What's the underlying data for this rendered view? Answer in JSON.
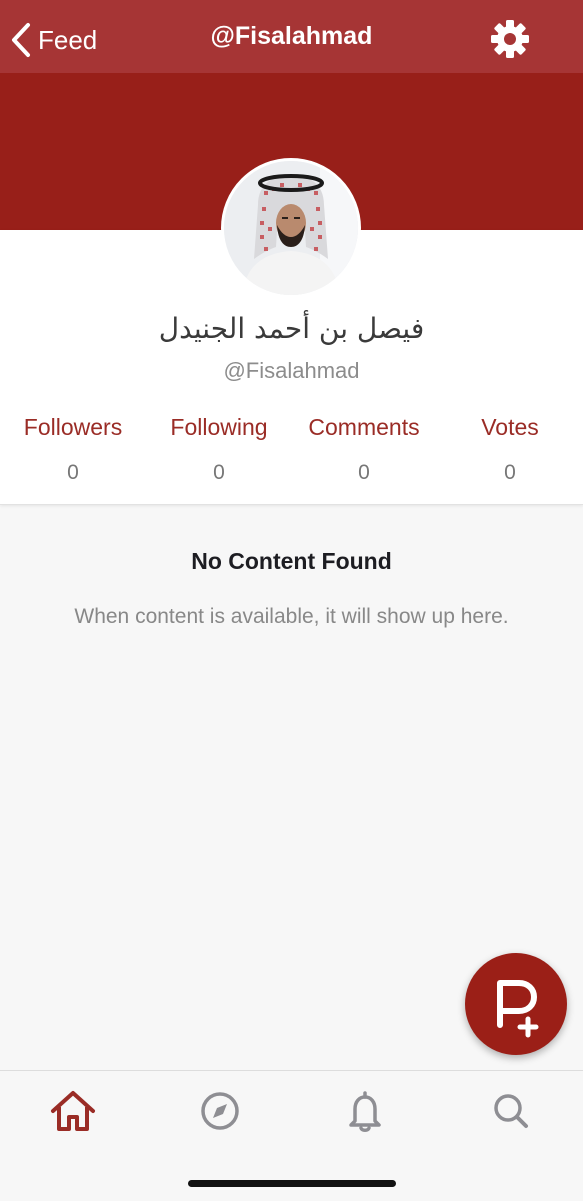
{
  "navbar": {
    "back_label": "Feed",
    "title": "@Fisalahmad",
    "settings_icon": "gear-icon"
  },
  "profile": {
    "display_name": "فيصل بن أحمد الجنيدل",
    "username": "@Fisalahmad"
  },
  "stats": [
    {
      "label": "Followers",
      "value": "0"
    },
    {
      "label": "Following",
      "value": "0"
    },
    {
      "label": "Comments",
      "value": "0"
    },
    {
      "label": "Votes",
      "value": "0"
    }
  ],
  "empty_state": {
    "title": "No Content Found",
    "message": "When content is available, it will show up here."
  },
  "fab": {
    "icon": "create-post-icon"
  },
  "tabs": [
    {
      "icon": "home-icon",
      "active": true
    },
    {
      "icon": "compass-icon",
      "active": false
    },
    {
      "icon": "bell-icon",
      "active": false
    },
    {
      "icon": "search-icon",
      "active": false
    }
  ],
  "colors": {
    "brand": "#a63535",
    "cover": "#981f19",
    "accent_text": "#9a2c26",
    "inactive_icon": "#8e8e93"
  }
}
